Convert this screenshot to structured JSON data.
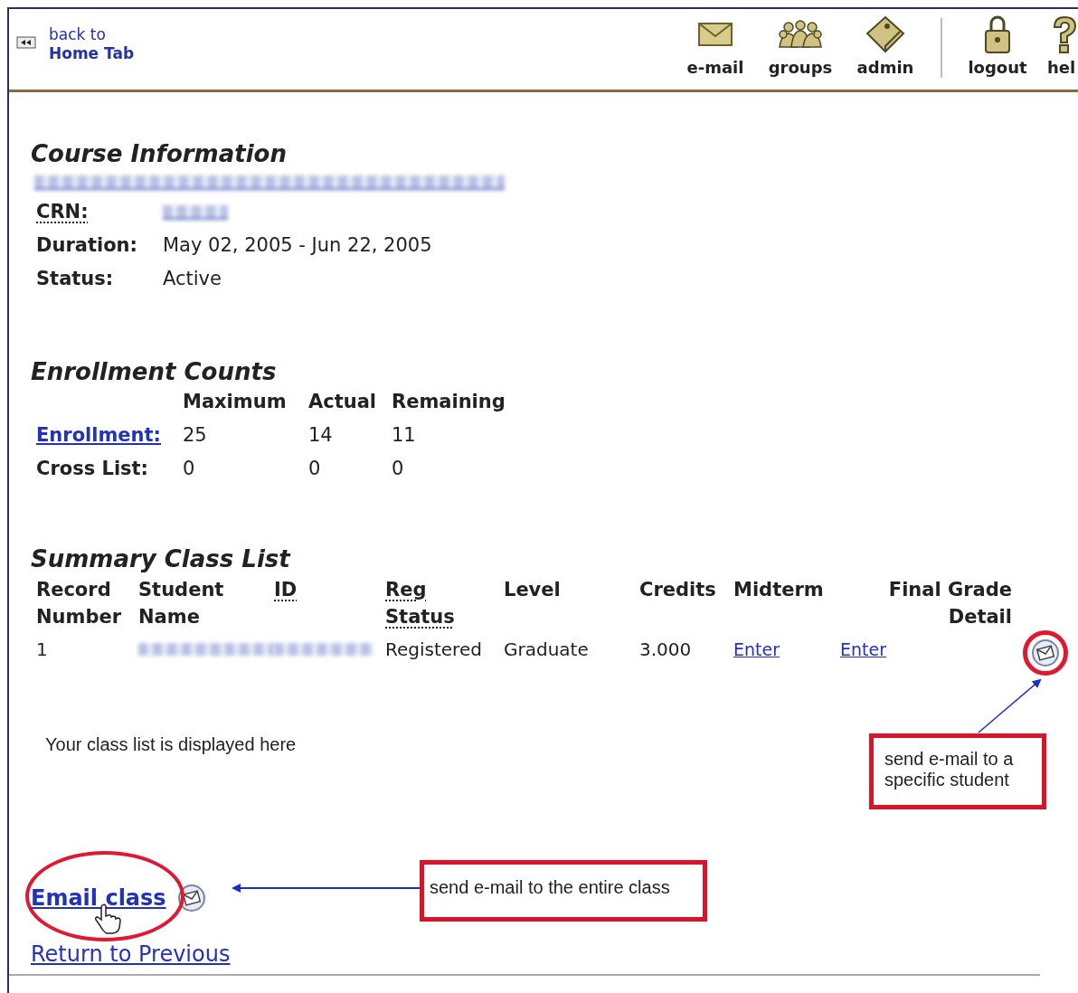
{
  "header": {
    "back_link": {
      "lines": [
        "back to",
        "Home Tab"
      ]
    },
    "nav": [
      {
        "kind": "envelope",
        "label": "e-mail"
      },
      {
        "kind": "group",
        "label": "groups"
      },
      {
        "kind": "admin",
        "label": "admin"
      },
      {
        "kind": "separator"
      },
      {
        "kind": "lock",
        "label": "logout"
      },
      {
        "kind": "help",
        "label": "hel"
      }
    ]
  },
  "course": {
    "heading": "Course Information",
    "title_link": {
      "redacted": true
    },
    "fields": [
      {
        "label": "CRN:",
        "redacted": true
      },
      {
        "label": "Duration:",
        "value": "May 02, 2005 - Jun 22, 2005"
      },
      {
        "label": "Status:",
        "value": "Active"
      }
    ]
  },
  "enrollment": {
    "heading": "Enrollment Counts",
    "columns": [
      "Maximum",
      "Actual",
      "Remaining"
    ],
    "rows": [
      {
        "label": "Enrollment:",
        "link": true,
        "values": [
          "25",
          "14",
          "11"
        ]
      },
      {
        "label": "Cross List:",
        "link": false,
        "values": [
          "0",
          "0",
          "0"
        ]
      }
    ]
  },
  "class_list": {
    "heading": "Summary Class List",
    "columns": [
      {
        "lines": [
          "Record",
          "Number"
        ],
        "dotted": false
      },
      {
        "lines": [
          "Student",
          "Name"
        ],
        "dotted": false
      },
      {
        "lines": [
          "ID"
        ],
        "dotted": true
      },
      {
        "lines": [
          "Reg",
          "Status"
        ],
        "dotted": true
      },
      {
        "lines": [
          "Level"
        ],
        "dotted": false
      },
      {
        "lines": [
          "Credits"
        ],
        "dotted": false
      },
      {
        "lines": [
          "Midterm"
        ],
        "dotted": false
      },
      {
        "lines": [
          "Final Grade",
          "Detail"
        ],
        "dotted": false
      }
    ],
    "rows": [
      {
        "cells": [
          {
            "text": "1"
          },
          {
            "redacted": true
          },
          {
            "redacted": true
          },
          {
            "text": "Registered"
          },
          {
            "text": "Graduate"
          },
          {
            "text": "3.000"
          },
          {
            "text": "Enter",
            "link": true
          },
          {
            "text": "Enter",
            "link": true
          }
        ],
        "email_icon": true,
        "highlighted": true
      }
    ]
  },
  "note": "Your class list is displayed here",
  "callouts": [
    {
      "text": "send e-mail to a specific student"
    },
    {
      "text": "send e-mail to the entire class"
    }
  ],
  "email_class": {
    "label": "Email class",
    "highlighted": true
  },
  "return_link": "Return to Previous"
}
